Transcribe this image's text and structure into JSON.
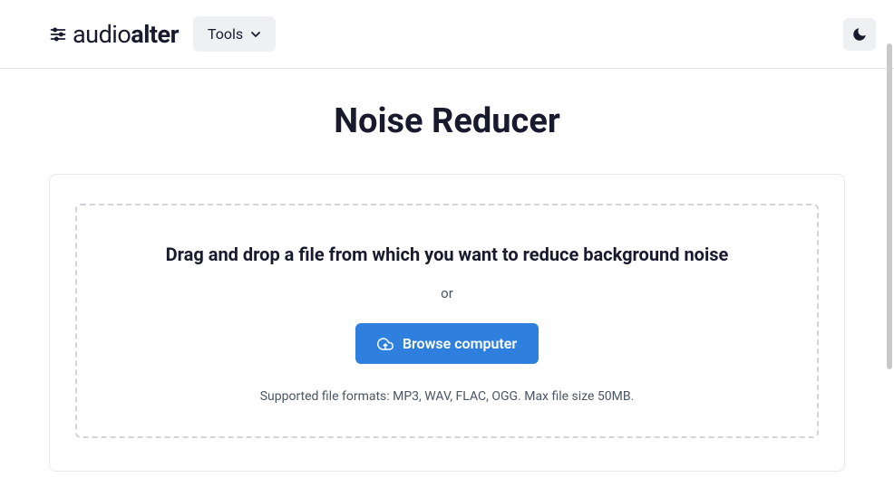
{
  "header": {
    "logo_prefix": "audio",
    "logo_suffix": "alter",
    "tools_label": "Tools"
  },
  "page": {
    "title": "Noise Reducer"
  },
  "dropzone": {
    "heading": "Drag and drop a file from which you want to reduce background noise",
    "or_label": "or",
    "browse_label": "Browse computer",
    "supported_text": "Supported file formats: MP3, WAV, FLAC, OGG. Max file size 50MB."
  }
}
